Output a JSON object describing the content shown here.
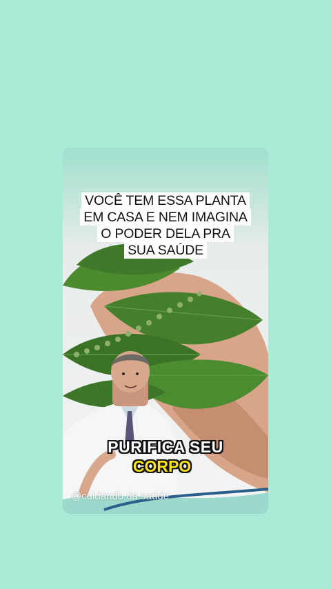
{
  "headline": {
    "line1": "VOCÊ TEM ESSA PLANTA",
    "line2": "EM CASA E NEM IMAGINA",
    "line3": "O PODER DELA PRA",
    "line4": "SUA SAÚDE"
  },
  "caption": {
    "line1": "PURIFICA SEU",
    "line2": "CORPO"
  },
  "watermark": "@cuidando da saúde",
  "colors": {
    "background": "#a8ecd8",
    "caption_highlight": "#ffe219",
    "leaf": "#3f7a2a"
  }
}
